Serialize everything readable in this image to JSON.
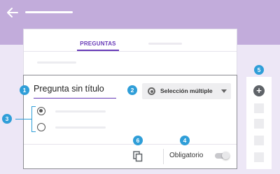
{
  "tabs": {
    "questions": "PREGUNTAS"
  },
  "question": {
    "title": "Pregunta sin título",
    "type": "Selección múltiple",
    "required_label": "Obligatorio"
  },
  "badges": [
    "1",
    "2",
    "3",
    "4",
    "5",
    "6"
  ],
  "colors": {
    "accent": "#673ab7",
    "header": "#c2acdb",
    "callout": "#2f9ed8",
    "background": "#ede7f6"
  }
}
